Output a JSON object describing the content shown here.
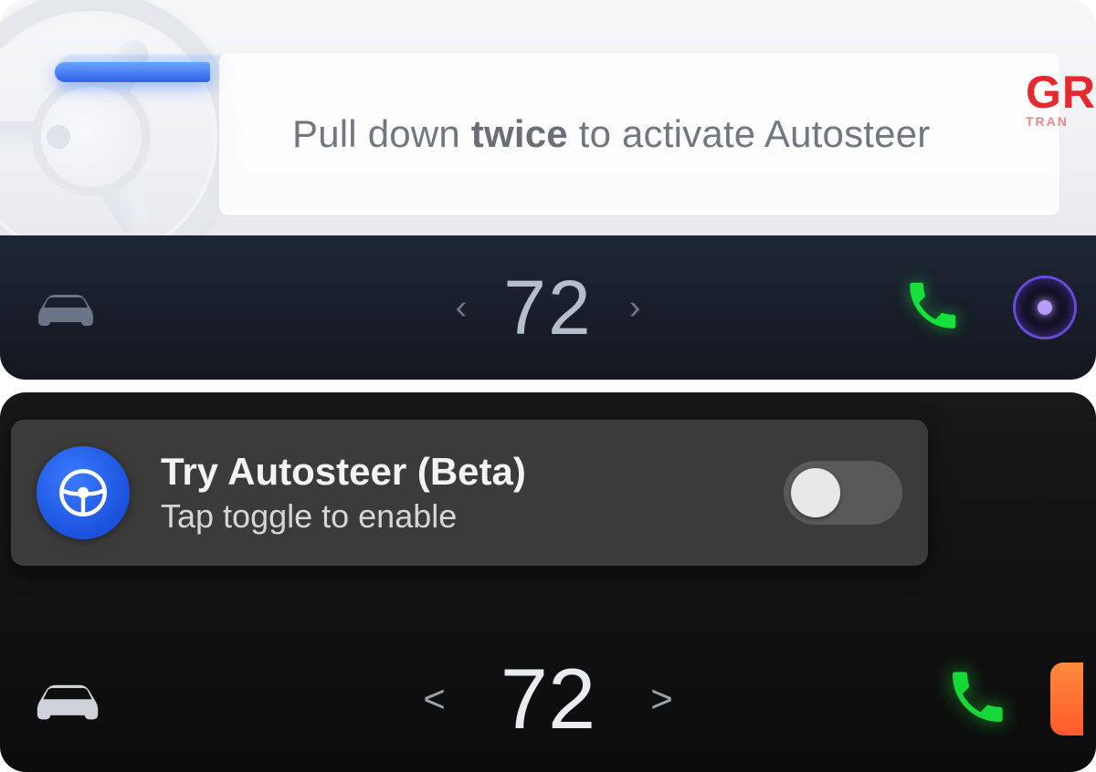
{
  "panel1": {
    "instruction": {
      "pre": "Pull down ",
      "bold": "twice",
      "post": " to activate Autosteer"
    },
    "brand_fragment": {
      "big": "GR",
      "small": "TRAN"
    },
    "dock": {
      "temperature": "72",
      "decrease_glyph": "‹",
      "increase_glyph": "›"
    }
  },
  "panel2": {
    "toast": {
      "title": "Try Autosteer (Beta)",
      "subtitle": "Tap toggle to enable",
      "toggle_on": false
    },
    "dock": {
      "temperature": "72",
      "decrease_glyph": "<",
      "increase_glyph": ">"
    }
  }
}
